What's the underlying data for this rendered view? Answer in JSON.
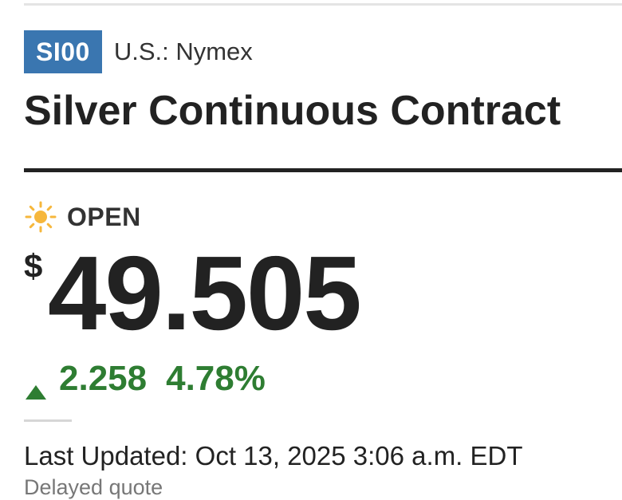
{
  "quote": {
    "ticker": "SI00",
    "exchange": "U.S.: Nymex",
    "name": "Silver Continuous Contract",
    "market_status": "OPEN",
    "status_icon": "sun-icon",
    "currency_symbol": "$",
    "price": "49.505",
    "change": "2.258",
    "change_percent": "4.78%",
    "change_direction": "up",
    "last_updated": "Last Updated: Oct 13, 2025 3:06 a.m. EDT",
    "delay_note": "Delayed quote"
  },
  "colors": {
    "badge_bg": "#3a76b0",
    "positive": "#2e7d32",
    "sun": "#f6b73c",
    "text": "#222222"
  }
}
